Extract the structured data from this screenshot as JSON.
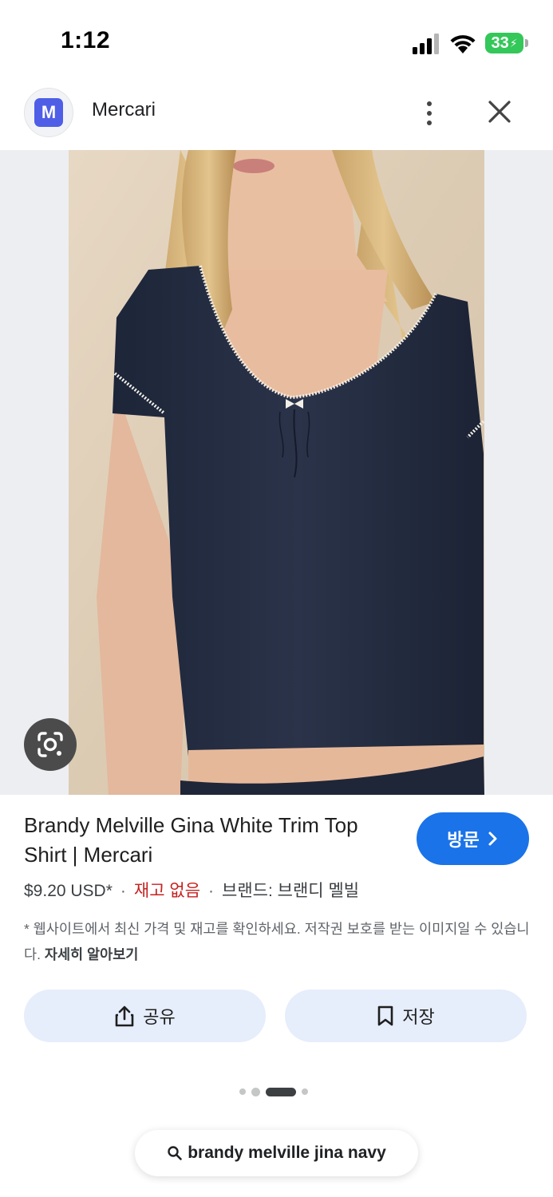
{
  "status_bar": {
    "time": "1:12",
    "battery": "33",
    "icons": [
      "signal-icon",
      "wifi-icon",
      "battery-icon"
    ]
  },
  "header": {
    "site_logo_letter": "M",
    "site_name": "Mercari",
    "icons": [
      "more-vert-icon",
      "close-icon"
    ]
  },
  "image": {
    "description_icon": "lens-icon"
  },
  "product": {
    "title": "Brandy Melville Gina White Trim Top Shirt | Mercari",
    "price": "$9.20 USD*",
    "separator": "·",
    "stock": "재고 없음",
    "brand": "브랜드: 브랜디 멜빌",
    "disclaimer": "* 웹사이트에서 최신 가격 및 재고를 확인하세요. 저작권 보호를 받는 이미지일 수 있습니다.",
    "learn_more": "자세히 알아보기"
  },
  "buttons": {
    "visit": "방문",
    "share": "공유",
    "save": "저장"
  },
  "search": {
    "query": "brandy melville jina navy"
  },
  "colors": {
    "accent_blue": "#1a73e8",
    "action_bg": "#e6edfb",
    "stock_red": "#c5221f",
    "battery_green": "#34c759"
  }
}
